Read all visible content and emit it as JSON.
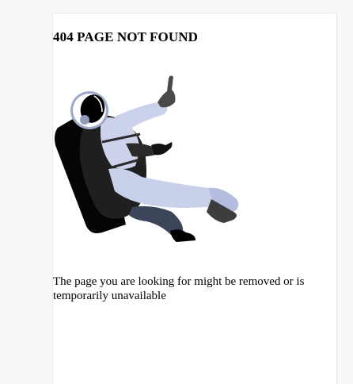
{
  "error": {
    "title": "404 PAGE NOT FOUND",
    "message": "The page you are looking for might be removed or is temporarily unavailable",
    "illustration": "astronaut-floating-illustration"
  },
  "colors": {
    "page_background": "#f8f8f8",
    "card_background": "#ffffff",
    "text": "#000000",
    "suit_light": "#c9d1eb",
    "suit_mid": "#b5bedf",
    "suit_dark": "#212121",
    "pants": "#3b4459",
    "gloves": "#4a4a4a",
    "boots": "#000000"
  }
}
